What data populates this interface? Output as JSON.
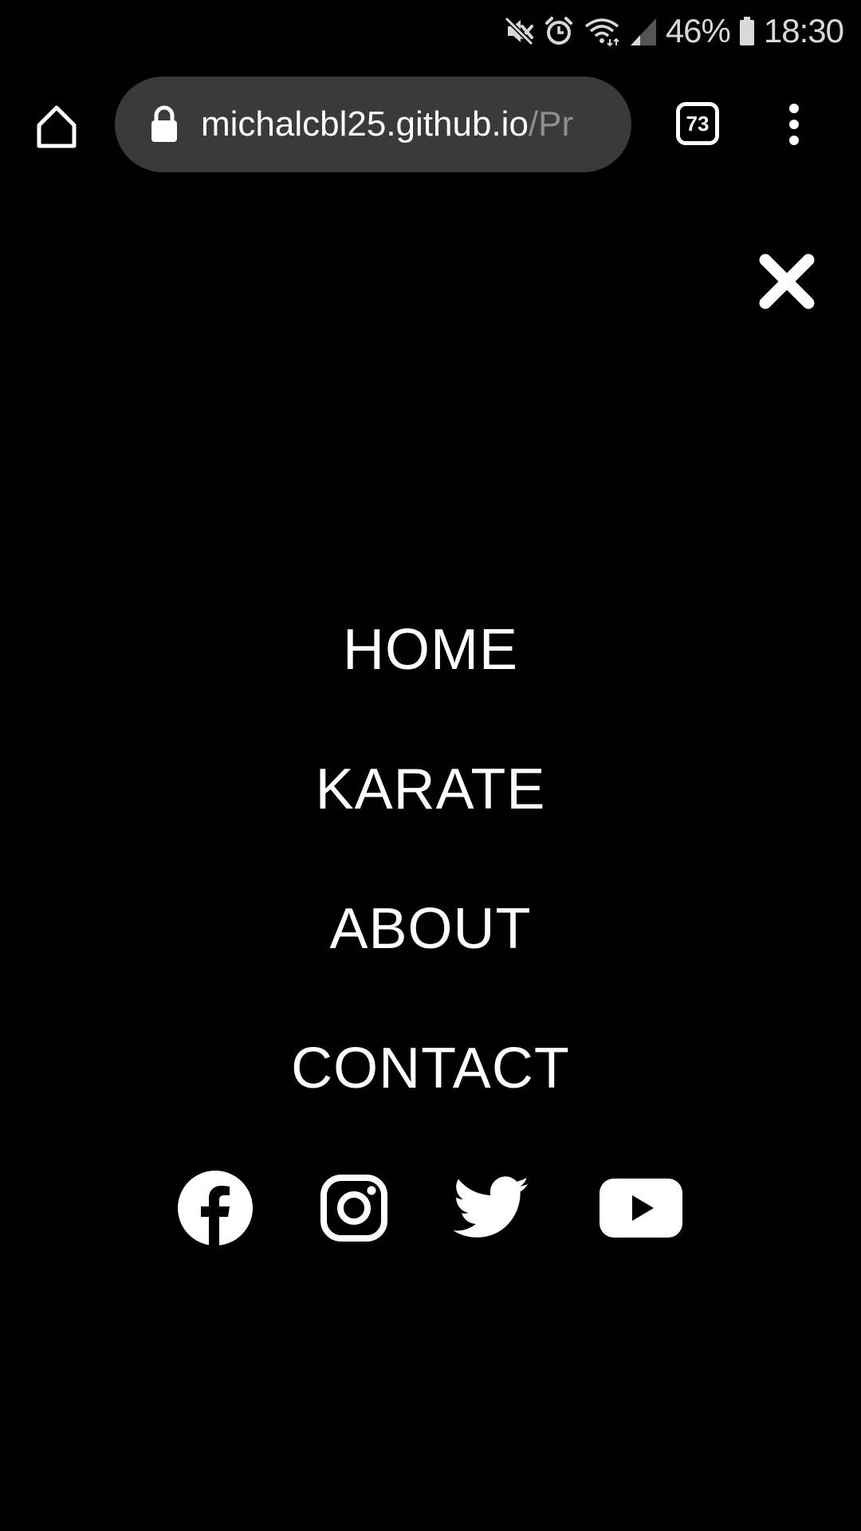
{
  "status_bar": {
    "battery": "46%",
    "clock": "18:30",
    "icons": [
      "mute-icon",
      "alarm-icon",
      "wifi-icon",
      "signal-icon",
      "battery-icon"
    ]
  },
  "browser": {
    "url_host": "michalcbl25.github.io",
    "url_path": "/Pr",
    "tab_count": "73",
    "icons": [
      "home-icon",
      "lock-icon",
      "tabs-icon",
      "more-vert-icon"
    ]
  },
  "menu": {
    "close_icon": "close-icon",
    "items": [
      {
        "label": "HOME"
      },
      {
        "label": "KARATE"
      },
      {
        "label": "ABOUT"
      },
      {
        "label": "CONTACT"
      }
    ],
    "socials": [
      "facebook-icon",
      "instagram-icon",
      "twitter-icon",
      "youtube-icon"
    ]
  },
  "colors": {
    "background": "#000000",
    "text": "#ffffff",
    "url_pill": "#3a3a3a",
    "url_path": "#8e8e8e"
  }
}
